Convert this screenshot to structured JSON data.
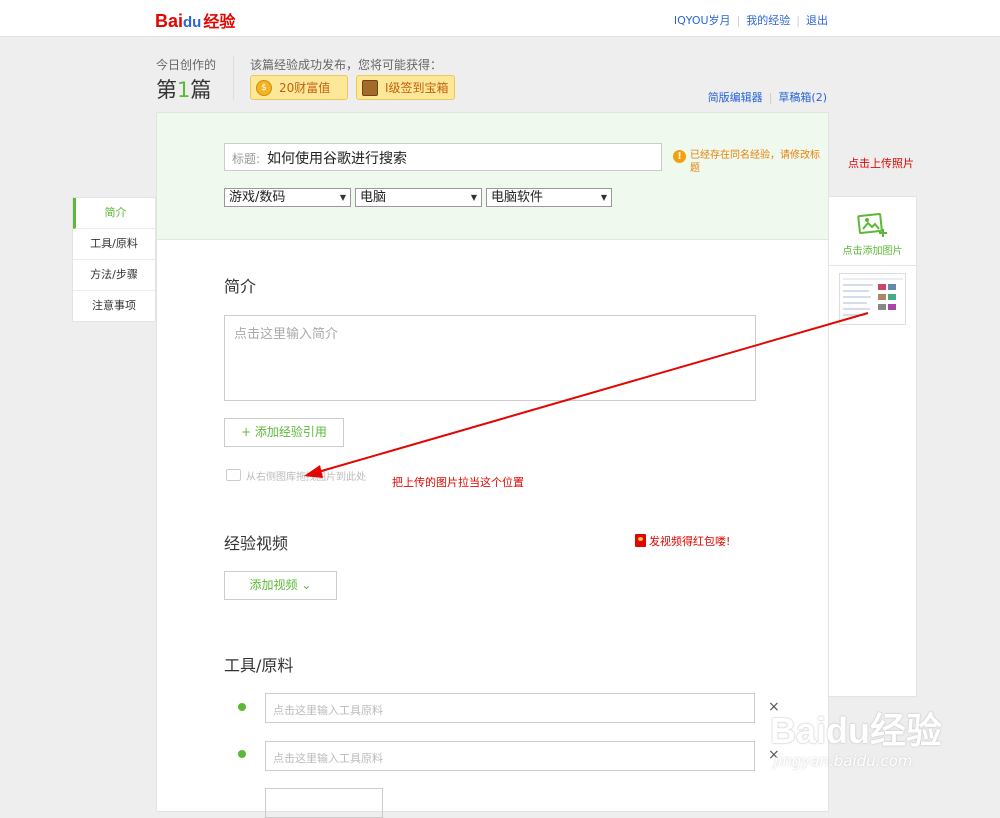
{
  "header": {
    "logo_bai": "Bai",
    "logo_du": "du",
    "logo_jingyan": "经验",
    "links": [
      "IQYOU岁月",
      "我的经验",
      "退出"
    ]
  },
  "stats": {
    "today_label": "今日创作的",
    "count_prefix": "第",
    "count_num": "1",
    "count_suffix": "篇",
    "reward_label": "该篇经验成功发布，您将可能获得：",
    "reward_wealth": "20财富值",
    "reward_chest": "I级签到宝箱"
  },
  "mini_links": {
    "simple_editor": "简版编辑器",
    "drafts": "草稿箱(2)"
  },
  "left_nav": [
    "简介",
    "工具/原料",
    "方法/步骤",
    "注意事项"
  ],
  "title": {
    "label": "标题:",
    "value": "如何使用谷歌进行搜索",
    "warning": "已经存在同名经验，请修改标题"
  },
  "categories": [
    "游戏/数码",
    "电脑",
    "电脑软件"
  ],
  "intro": {
    "heading": "简介",
    "placeholder": "点击这里输入简介",
    "add_ref_button": "+ 添加经验引用",
    "drag_hint": "从右侧图库拖拽图片到此处"
  },
  "video": {
    "heading": "经验视频",
    "add_button": "添加视频",
    "redpacket": "发视频得红包喽!"
  },
  "tools": {
    "heading": "工具/原料",
    "placeholder": "点击这里输入工具原料",
    "delete_symbol": "×"
  },
  "right_panel": {
    "upload_label": "点击添加图片"
  },
  "annotations": {
    "upload_tip": "点击上传照片",
    "drag_tip": "把上传的图片拉当这个位置",
    "arrow_color": "#e10602"
  },
  "watermark": {
    "logo": "Baidu经验",
    "url": "jingyan.baidu.com"
  },
  "colors": {
    "brand_green": "#5cb836",
    "baidu_red": "#e10602",
    "link_blue": "#2b64d8"
  }
}
